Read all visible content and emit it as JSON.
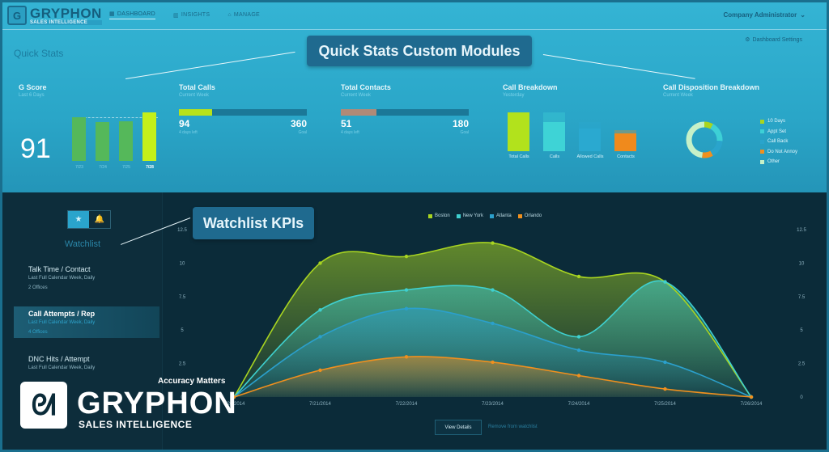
{
  "navbar": {
    "logo": {
      "name": "GRYPHON",
      "sub": "SALES INTELLIGENCE"
    },
    "items": [
      {
        "label": "DASHBOARD",
        "icon": "grid-icon",
        "active": true
      },
      {
        "label": "INSIGHTS",
        "icon": "bar-chart-icon",
        "active": false
      },
      {
        "label": "MANAGE",
        "icon": "building-icon",
        "active": false
      }
    ],
    "user": "Company Administrator",
    "user_chevron": "⌄"
  },
  "quick_stats": {
    "title": "Quick Stats",
    "settings_label": "Dashboard Settings",
    "callout": "Quick Stats Custom Modules",
    "gscore": {
      "title": "G Score",
      "subtitle": "Last 6 Days",
      "value": "91",
      "bars": [
        {
          "label": "7/23",
          "value": 91,
          "current": false
        },
        {
          "label": "7/24",
          "value": 80,
          "current": false
        },
        {
          "label": "7/25",
          "value": 82,
          "current": false
        },
        {
          "label": "7/28",
          "value": 101,
          "current": true
        }
      ],
      "reference": 91
    },
    "total_calls": {
      "title": "Total Calls",
      "subtitle": "Current Week",
      "value": "94",
      "goal": "360",
      "progress": 0.26,
      "left_caption": "4 days left",
      "right_caption": "Goal",
      "color": "#b8e21a"
    },
    "total_contacts": {
      "title": "Total Contacts",
      "subtitle": "Current Week",
      "value": "51",
      "goal": "180",
      "progress": 0.28,
      "left_caption": "4 days left",
      "right_caption": "Goal",
      "color": "#b08a77"
    },
    "call_breakdown": {
      "title": "Call Breakdown",
      "subtitle": "Yesterday",
      "bars": [
        {
          "label": "Total Calls",
          "value": 100,
          "ghost": 100,
          "color": "#b2e21c"
        },
        {
          "label": "Calls",
          "value": 74,
          "ghost": 100,
          "color": "#3ed3d6"
        },
        {
          "label": "Allowed Calls",
          "value": 58,
          "ghost": 74,
          "color": "#2aa9d0"
        },
        {
          "label": "Contacts",
          "value": 45,
          "ghost": 55,
          "color": "#f08a1c"
        }
      ]
    },
    "call_disposition": {
      "title": "Call Disposition Breakdown",
      "subtitle": "Current Week",
      "slices": [
        {
          "label": "10 Days",
          "value": 8,
          "color": "#a9d51e"
        },
        {
          "label": "Appt Set",
          "value": 18,
          "color": "#3dd0d6"
        },
        {
          "label": "Call Back",
          "value": 16,
          "color": "#2aa4cc"
        },
        {
          "label": "Do Not Annoy",
          "value": 10,
          "color": "#f0901e"
        },
        {
          "label": "Other",
          "value": 48,
          "color": "#c6f1c8"
        }
      ]
    }
  },
  "watchlist": {
    "title": "Watchlist",
    "callout": "Watchlist KPIs",
    "toggle": [
      {
        "icon": "star-icon",
        "glyph": "★",
        "active": true
      },
      {
        "icon": "bell-icon",
        "glyph": "🔔",
        "active": false
      }
    ],
    "items": [
      {
        "name": "Talk Time / Contact",
        "desc": "Last Full Calendar Week, Daily",
        "count": "2 Offices",
        "selected": false
      },
      {
        "name": "Call Attempts / Rep",
        "desc": "Last Full Calendar Week, Daily",
        "count": "4 Offices",
        "selected": true
      },
      {
        "name": "DNC Hits / Attempt",
        "desc": "Last Full Calendar Week, Daily",
        "count": "",
        "selected": false
      }
    ],
    "view_details": "View Details",
    "remove": "Remove from watchlist"
  },
  "brand": {
    "tagline": "Accuracy Matters",
    "name": "GRYPHON",
    "sub": "SALES INTELLIGENCE"
  },
  "chart_data": {
    "type": "area",
    "title": "",
    "xlabel": "",
    "ylabel": "",
    "x": [
      "7/20/2014",
      "7/21/2014",
      "7/22/2014",
      "7/23/2014",
      "7/24/2014",
      "7/25/2014",
      "7/26/2014"
    ],
    "ylim": [
      0,
      12.5
    ],
    "yticks": [
      0,
      2.5,
      5,
      7.5,
      10,
      12.5
    ],
    "ytick_labels": [
      "0",
      "2.5",
      "5",
      "7.5",
      "10",
      "12.5"
    ],
    "legend_position": "top-center",
    "grid": false,
    "series": [
      {
        "name": "Boston",
        "color": "#a8d421",
        "values": [
          0,
          10,
          10.5,
          11.5,
          9,
          8.6,
          0
        ]
      },
      {
        "name": "New York",
        "color": "#3fd0cf",
        "values": [
          0,
          6.5,
          8,
          8,
          4.5,
          8.6,
          0
        ]
      },
      {
        "name": "Atlanta",
        "color": "#2ba0cc",
        "values": [
          0,
          4.5,
          6.6,
          5.5,
          3.5,
          2.6,
          0
        ]
      },
      {
        "name": "Orlando",
        "color": "#f0901e",
        "values": [
          0,
          2,
          3,
          2.6,
          1.6,
          0.6,
          0
        ]
      }
    ]
  }
}
